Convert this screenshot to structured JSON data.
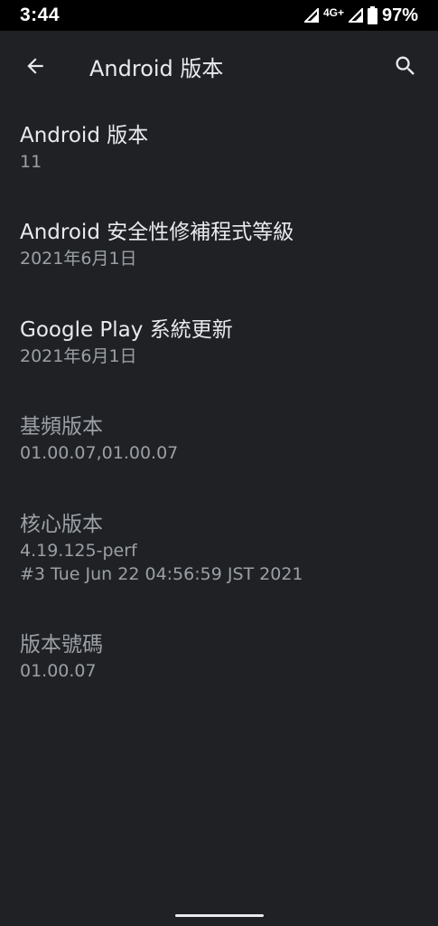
{
  "status_bar": {
    "time": "3:44",
    "network": "4G+",
    "battery_percent": "97%",
    "icons": [
      "signal-icon",
      "wifi-icon",
      "signal-icon",
      "battery-icon"
    ]
  },
  "app_bar": {
    "title": "Android 版本",
    "back_icon": "arrow-back-icon",
    "search_icon": "search-icon"
  },
  "items": [
    {
      "title": "Android 版本",
      "summary": "11",
      "enabled": true
    },
    {
      "title": "Android 安全性修補程式等級",
      "summary": "2021年6月1日",
      "enabled": true
    },
    {
      "title": "Google Play 系統更新",
      "summary": "2021年6月1日",
      "enabled": true
    },
    {
      "title": "基頻版本",
      "summary": "01.00.07,01.00.07",
      "enabled": false
    },
    {
      "title": "核心版本",
      "summary": "4.19.125-perf\n#3 Tue Jun 22 04:56:59 JST 2021",
      "enabled": false
    },
    {
      "title": "版本號碼",
      "summary": "01.00.07",
      "enabled": false
    }
  ]
}
